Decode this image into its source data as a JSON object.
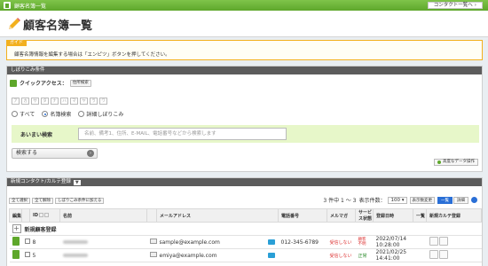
{
  "titlebar": {
    "title": "顧客名簿一覧",
    "contact_button": "コンタクト一覧へ"
  },
  "header": {
    "title": "顧客名簿一覧"
  },
  "guide": {
    "tab": "ガイド",
    "text": "顧客名簿情報を編集する場合は「エンピツ」ボタンを押してください。"
  },
  "search": {
    "title": "しぼりこみ条件",
    "quick_access": "クイックアクセス：",
    "quick_access_pill": "住所検索",
    "kana": [
      "ア",
      "カ",
      "サ",
      "タ",
      "ナ",
      "ハ",
      "マ",
      "ヤ",
      "ラ",
      "ワ"
    ],
    "radio_all": "すべて",
    "radio_name": "名簿検索",
    "radio_detail": "詳細しぼりこみ",
    "fuzzy_label": "あいまい検索",
    "fuzzy_placeholder": "名前、備考1、住所、E-MAIL、電話番号などから検索します",
    "search_button": "検索する",
    "advanced_button": "高度なデータ操作"
  },
  "list": {
    "title": "新規コンタクト/カルテ登録",
    "select_all": "全て選択",
    "deselect_all": "全て解除",
    "narrow": "しぼりこみ条件に加える",
    "count": "3 件中 1 ～ 3",
    "per_page_label": "表示件数：",
    "per_page": "100",
    "per_page_change": "表示数変更",
    "toggle_list": "一覧",
    "toggle_detail": "詳細",
    "columns": {
      "edit": "編集",
      "id": "ID",
      "name": "名前",
      "email": "メールアドレス",
      "phone": "電話番号",
      "mailmag": "メルマガ",
      "service": "サービス状態",
      "registered": "登録日時",
      "list": "一覧",
      "new_chart": "新規カルテ登録"
    },
    "new_row": "新規顧客登録",
    "rows": [
      {
        "id": "8",
        "email": "sample@example.com",
        "phone": "012-345-6789",
        "mailmag": "受信しない",
        "status": "顧客\n不明",
        "date": "2022/07/14",
        "time": "10:28:00"
      },
      {
        "id": "5",
        "email": "emiya@example.com",
        "phone": "",
        "mailmag": "受信しない",
        "status": "正常",
        "date": "2021/02/25",
        "time": "14:41:00"
      }
    ]
  }
}
